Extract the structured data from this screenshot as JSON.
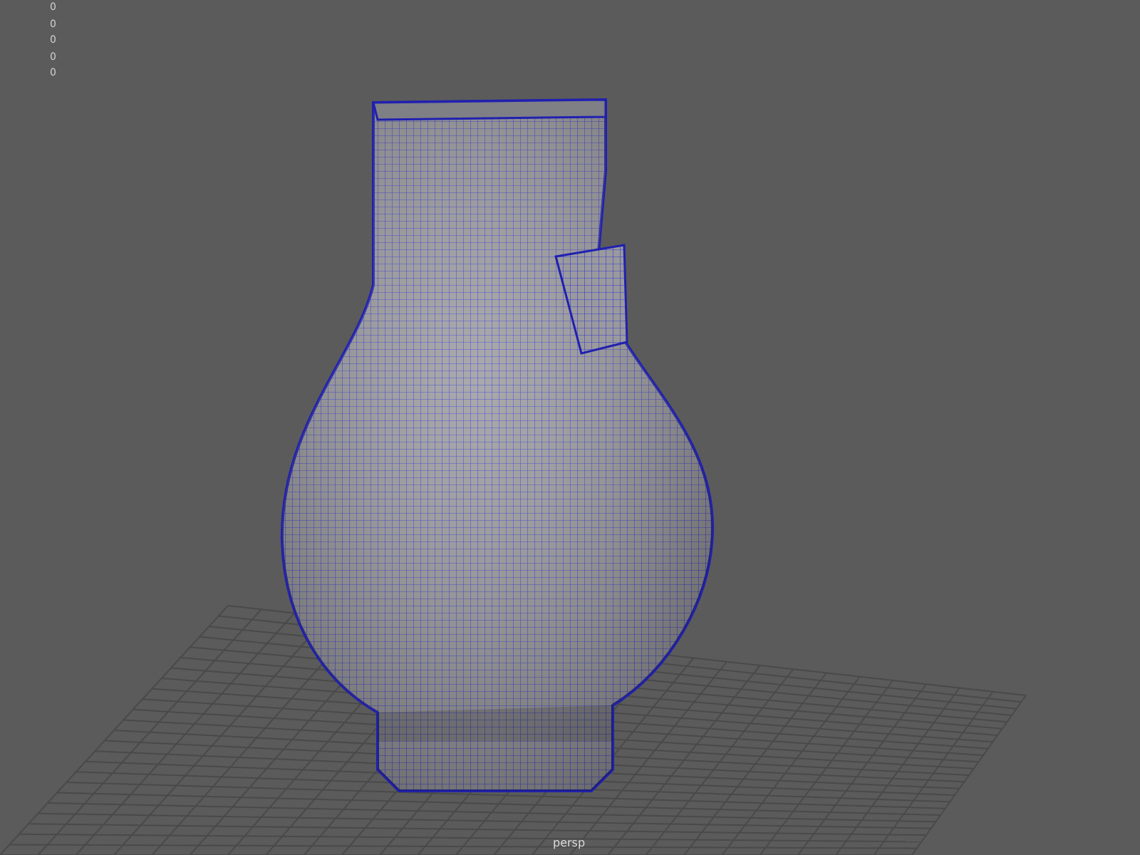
{
  "hud": {
    "values": [
      "0",
      "0",
      "0",
      "0",
      "0"
    ]
  },
  "viewport": {
    "camera_label": "persp"
  }
}
